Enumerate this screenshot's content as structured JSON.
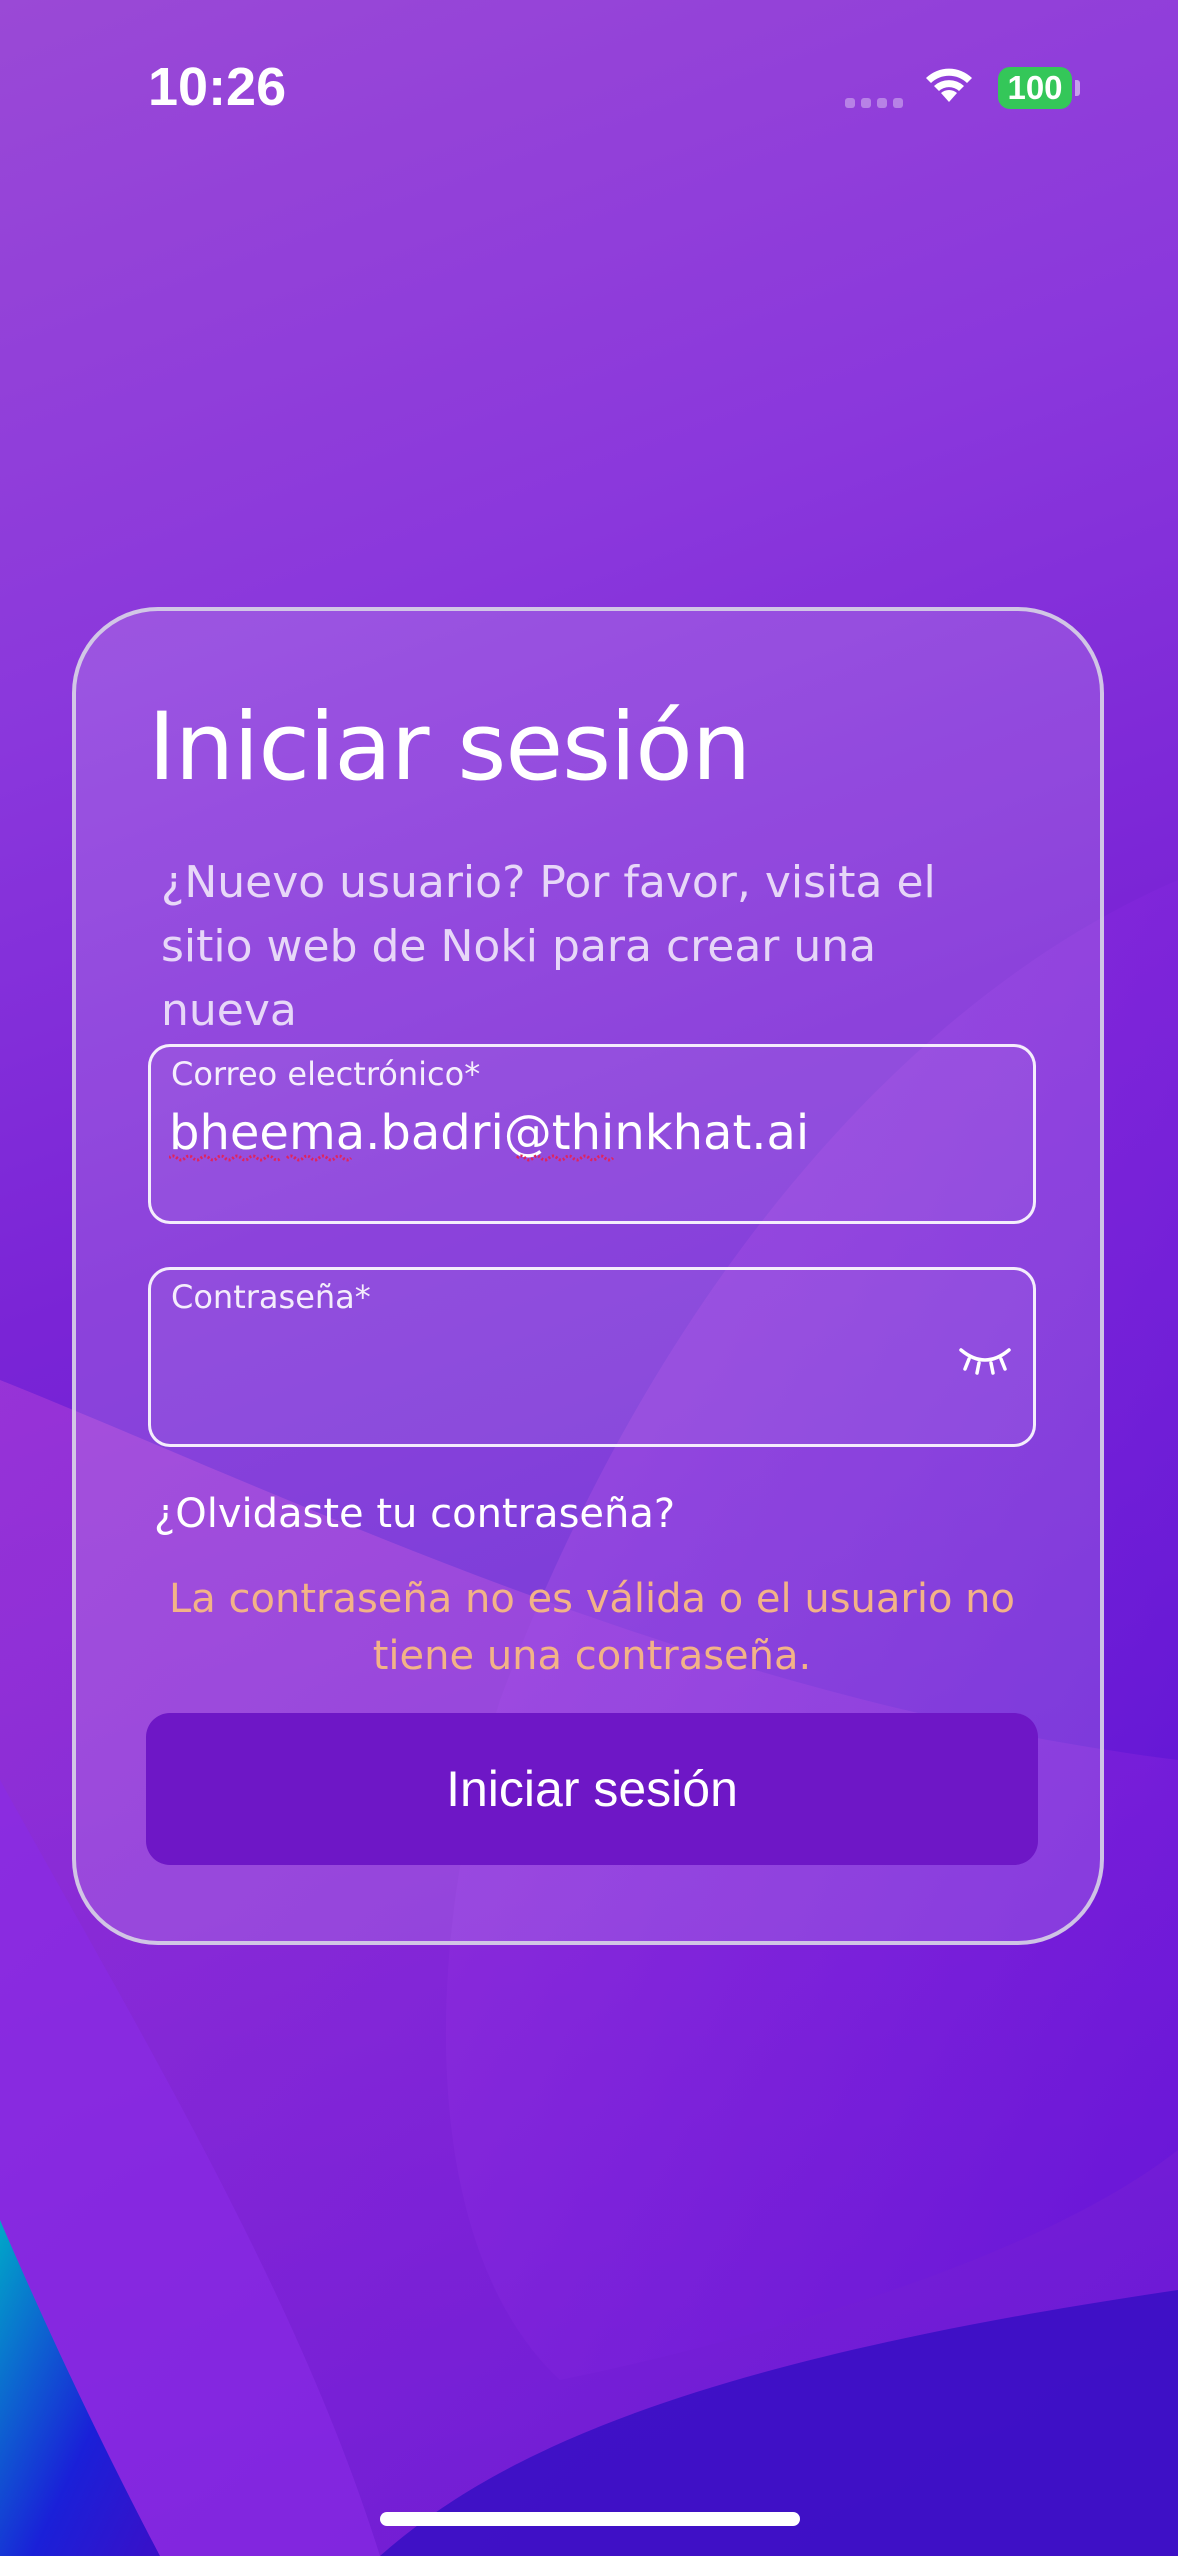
{
  "status_bar": {
    "time": "10:26",
    "battery": "100",
    "battery_color": "#34c759"
  },
  "login": {
    "title": "Iniciar sesión",
    "subtitle": "¿Nuevo usuario? Por favor, visita el sitio web de Noki para crear una nueva",
    "email_label": "Correo electrónico*",
    "email_value": "bheema.badri@thinkhat.ai",
    "password_label": "Contraseña*",
    "password_value": "",
    "password_toggle_icon": "eye-closed-icon",
    "forgot_link": "¿Olvidaste tu contraseña?",
    "error_message": "La contraseña no es válida o el usuario no tiene una contraseña.",
    "submit_label": "Iniciar sesión",
    "error_color": "#f3b387",
    "button_color": "#6e17c6"
  }
}
